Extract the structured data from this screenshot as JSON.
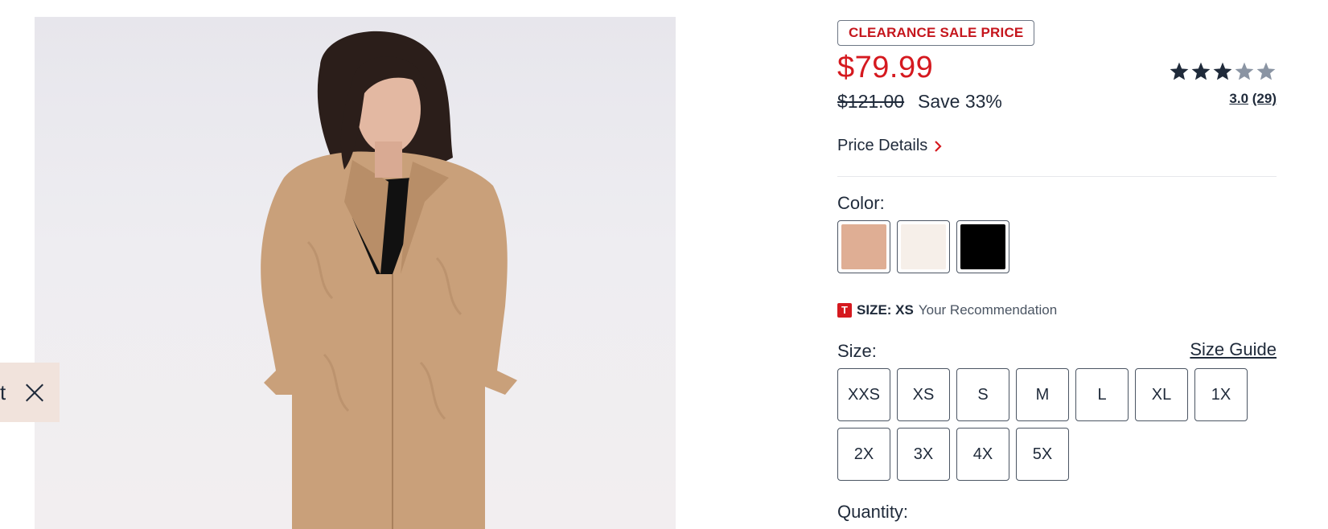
{
  "product_image": {
    "alt": "Woman wearing a tan quilted long coat over a black top"
  },
  "feedback_tab": {
    "label": "t"
  },
  "badge": "CLEARANCE SALE PRICE",
  "pricing": {
    "sale_price": "$79.99",
    "original_price": "$121.00",
    "save": "Save 33%"
  },
  "rating": {
    "value": "3.0",
    "count": "(29)",
    "stars_filled": 3,
    "stars_total": 5
  },
  "price_details": "Price Details",
  "color": {
    "label": "Color:",
    "swatches": [
      {
        "name": "tan",
        "hex": "#dfae94"
      },
      {
        "name": "cream",
        "hex": "#f6efe9"
      },
      {
        "name": "black",
        "hex": "#000000"
      }
    ]
  },
  "size_recommendation": {
    "icon": "T",
    "size_text": "SIZE: XS",
    "text": "Your Recommendation"
  },
  "size": {
    "label": "Size:",
    "guide": "Size Guide",
    "options": [
      "XXS",
      "XS",
      "S",
      "M",
      "L",
      "XL",
      "1X",
      "2X",
      "3X",
      "4X",
      "5X"
    ]
  },
  "quantity": {
    "label": "Quantity:"
  },
  "colors": {
    "accent_red": "#d5191f",
    "text_dark": "#1f2a3a",
    "star_filled": "#1f2a3a",
    "star_empty": "#8a94a3",
    "feedback_bg": "#f1e3dc"
  }
}
